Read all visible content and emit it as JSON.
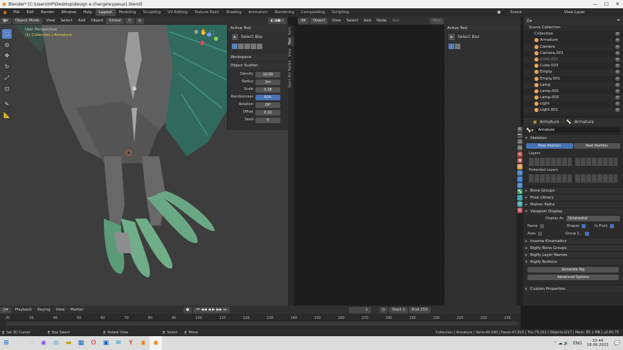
{
  "window": {
    "title": "Blender* [C:\\Users\\HP\\Desktop\\design в change\\курица1.blend]",
    "controls": [
      "—",
      "☐",
      "✕"
    ]
  },
  "menubar": {
    "items": [
      "File",
      "Edit",
      "Render",
      "Window",
      "Help"
    ],
    "workspaces": [
      "Layout",
      "Modeling",
      "Sculpting",
      "UV Editing",
      "Texture Paint",
      "Shading",
      "Animation",
      "Rendering",
      "Compositing",
      "Scripting"
    ],
    "active_workspace": "Layout",
    "scene": "Scene",
    "view_layer": "View Layer"
  },
  "viewport": {
    "mode": "Object Mode",
    "menus": [
      "View",
      "Select",
      "Add",
      "Object"
    ],
    "orientation": "Global",
    "overlay_title": "User Perspective",
    "overlay_subtitle": "(1) Collection | Armature"
  },
  "npanel": {
    "active_tool_title": "Active Tool",
    "select_label": "Select Box",
    "workspace_title": "Workspace",
    "scatter_title": "Object Scatter",
    "fields": [
      {
        "label": "Density",
        "value": "10.00"
      },
      {
        "label": "Radius",
        "value": "1m"
      },
      {
        "label": "Scale",
        "value": "0.38"
      },
      {
        "label": "Randomness",
        "value": "50%"
      },
      {
        "label": "Rotation",
        "value": "29°"
      },
      {
        "label": "Offset",
        "value": "0.10"
      },
      {
        "label": "Seed",
        "value": "0"
      }
    ],
    "tabs": [
      "Item",
      "Tool",
      "View",
      "Sport Art Toolkit"
    ]
  },
  "node_editor": {
    "type": "Object",
    "menus": [
      "View",
      "Select",
      "Add",
      "Node"
    ],
    "slot": "Slot",
    "new_label": "New",
    "tool_title": "Active Tool",
    "select_label": "Select Box"
  },
  "outliner": {
    "root": "Scene Collection",
    "collection": "Collection",
    "items": [
      {
        "name": "Armature",
        "color": "#e8a45c"
      },
      {
        "name": "Camera",
        "color": "#e8a45c"
      },
      {
        "name": "Camera.001",
        "color": "#e8a45c"
      },
      {
        "name": "Cube.001",
        "color": "#e8a45c",
        "dim": true
      },
      {
        "name": "Cube.003",
        "color": "#e8a45c"
      },
      {
        "name": "Empty",
        "color": "#e8a45c"
      },
      {
        "name": "Empty.001",
        "color": "#e8a45c"
      },
      {
        "name": "Lamp",
        "color": "#e8a45c"
      },
      {
        "name": "Lamp.001",
        "color": "#e8a45c"
      },
      {
        "name": "Lamp.002",
        "color": "#e8a45c"
      },
      {
        "name": "Light",
        "color": "#e8a45c"
      },
      {
        "name": "Light.001",
        "color": "#e8a45c"
      }
    ]
  },
  "properties": {
    "object": "Armature",
    "data": "Armature",
    "datablock": "Armature",
    "skeleton": "Skeleton",
    "pose_position": "Pose Position",
    "rest_position": "Rest Position",
    "layers": "Layers",
    "protected_layers": "Protected Layers",
    "sections_top": [
      "Bone Groups",
      "Pose Library",
      "Motion Paths"
    ],
    "viewport_display": "Viewport Display",
    "display_as_label": "Display As",
    "display_as_value": "Octahedral",
    "name_label": "Name",
    "shapes_label": "Shapes",
    "in_front_label": "In Front",
    "axes_label": "Axes",
    "group_label": "Group C...",
    "sections_bottom": [
      "Inverse Kinematics",
      "Rigify Bone Groups",
      "Rigify Layer Names",
      "Rigify Buttons"
    ],
    "generate_rig": "Generate Rig",
    "advanced_options": "Advanced Options",
    "custom_properties": "Custom Properties"
  },
  "timeline": {
    "menus": [
      "Playback",
      "Keying",
      "View",
      "Marker"
    ],
    "current_frame": "1",
    "start_label": "Start",
    "start": "1",
    "end_label": "End",
    "end": "250",
    "ticks": [
      "20",
      "30",
      "40",
      "50",
      "60",
      "70",
      "80",
      "90",
      "100",
      "110",
      "120",
      "130",
      "140",
      "150",
      "160",
      "170",
      "180",
      "190",
      "200",
      "210",
      "220",
      "230"
    ]
  },
  "statusbar": {
    "left": [
      "Set 3D Cursor",
      "Box Select",
      "Rotate View",
      "Select",
      "Move"
    ],
    "stats": "Collection | Armature | Verts:40,580 | Faces:47,810 | Tris:79,162 | Objects:0/17 | Mem: 85.1 MB | v2.80.75"
  },
  "taskbar": {
    "lang": "ENG",
    "time": "10:44",
    "date": "18.06.2021"
  }
}
